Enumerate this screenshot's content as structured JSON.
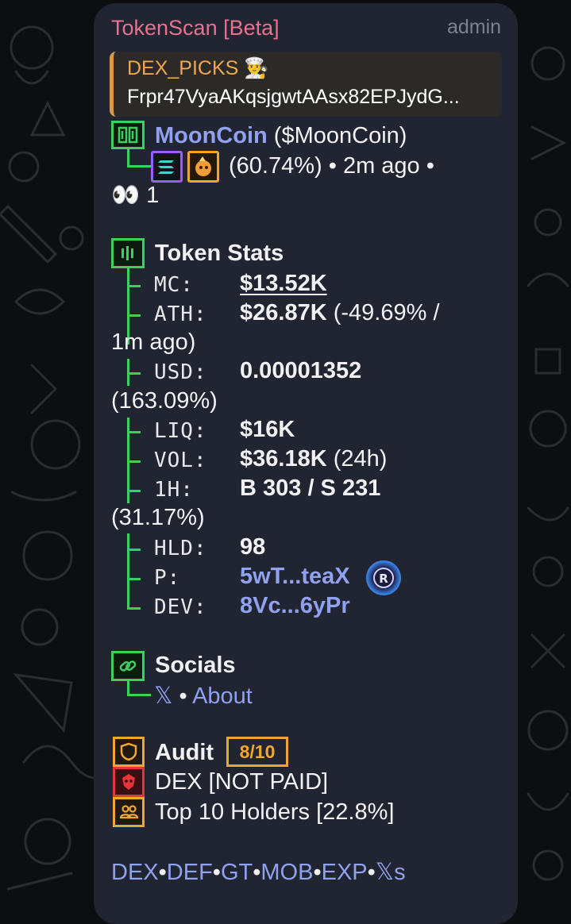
{
  "header": {
    "sender": "TokenScan [Beta]",
    "via": "admin"
  },
  "reply": {
    "title": "DEX_PICKS 👨‍🍳",
    "text": "Frpr47VyaAKqsjgwtAAsx82EPJydG..."
  },
  "token": {
    "name": "MoonCoin",
    "ticker": "($MoonCoin)",
    "meta": "(60.74%) • 2m ago •",
    "eyes": "👀 1"
  },
  "stats": {
    "title": "Token Stats",
    "mc_label": "MC:",
    "mc_value": "$13.52K",
    "ath_label": "ATH:",
    "ath_value": "$26.87K",
    "ath_extra": "(-49.69% /",
    "ath_wrap": "1m ago)",
    "usd_label": "USD:",
    "usd_value": "0.00001352",
    "usd_wrap": "(163.09%)",
    "liq_label": "LIQ:",
    "liq_value": "$16K",
    "vol_label": "VOL:",
    "vol_value": "$36.18K",
    "vol_extra": "(24h)",
    "h1_label": "1H:",
    "h1_value": "B 303 / S 231",
    "h1_wrap": "(31.17%)",
    "hld_label": "HLD:",
    "hld_value": "98",
    "p_label": "P:",
    "p_value": "5wT...teaX",
    "dev_label": "DEV:",
    "dev_value": "8Vc...6yPr"
  },
  "socials": {
    "title": "Socials",
    "x": "𝕏",
    "sep": "•",
    "about": "About"
  },
  "audit": {
    "title": "Audit",
    "score": "8/10",
    "dex": "DEX [NOT PAID]",
    "holders": "Top 10 Holders [22.8%]"
  },
  "footer_links": [
    "DEX",
    "DEF",
    "GT",
    "MOB",
    "EXP",
    "𝕏s"
  ],
  "footer_sep": "•",
  "colors": {
    "accent_green": "#3ecf5e",
    "accent_orange": "#f0a632",
    "link": "#8fa1ef",
    "sender": "#e8718f"
  }
}
